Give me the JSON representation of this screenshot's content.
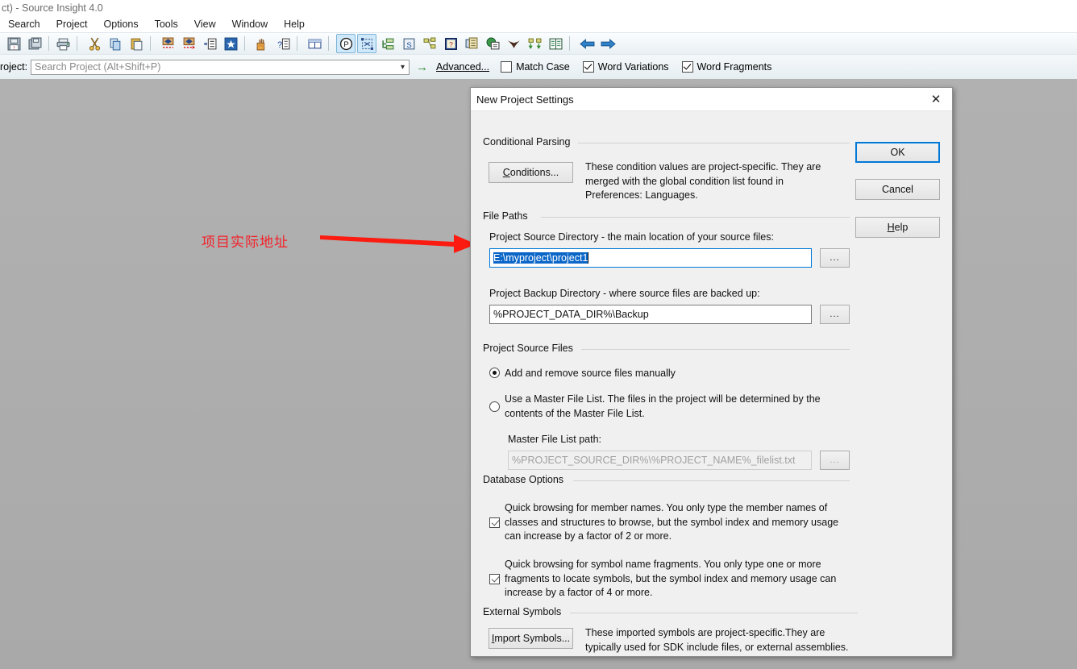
{
  "window": {
    "title": "ct) - Source Insight 4.0"
  },
  "menubar": {
    "items": [
      "Search",
      "Project",
      "Options",
      "Tools",
      "View",
      "Window",
      "Help"
    ]
  },
  "toolbar": {
    "groups": [
      [
        "save-icon",
        "save-all-icon"
      ],
      [
        "print-icon"
      ],
      [
        "cut-icon",
        "copy-icon",
        "paste-icon"
      ],
      [
        "jump-back-icon",
        "jump-forward-icon",
        "indent-icon",
        "bookmark-icon"
      ],
      [
        "highlight-icon",
        "context-help-icon"
      ],
      [
        "tile-windows-icon"
      ],
      [
        "parse-icon",
        "select-block-icon",
        "outline-icon",
        "symbol-window-icon",
        "relation-window-icon",
        "context-window-icon",
        "clip-window-icon",
        "browse-project-icon",
        "web-icon",
        "bird-icon",
        "sync-icon",
        "file-list-icon"
      ],
      [
        "back-arrow-icon",
        "forward-arrow-icon"
      ]
    ]
  },
  "search": {
    "label": "roject:",
    "placeholder": "Search Project (Alt+Shift+P)",
    "value": "",
    "go_label": "→",
    "advanced_label": "Advanced...",
    "options": [
      {
        "label": "Match Case",
        "checked": false
      },
      {
        "label": "Word Variations",
        "checked": true
      },
      {
        "label": "Word Fragments",
        "checked": true
      }
    ]
  },
  "annotation": {
    "text": "项目实际地址",
    "color": "#f3222a",
    "arrow": "right-arrow-annotation"
  },
  "dialog": {
    "title": "New Project Settings",
    "close_label": "✕",
    "buttons": {
      "ok": "OK",
      "cancel": "Cancel",
      "help": "Help"
    },
    "conditional_parsing": {
      "legend": "Conditional Parsing",
      "button": "Conditions...",
      "description": "These condition values are project-specific.  They are merged with the global condition list found in Preferences: Languages."
    },
    "file_paths": {
      "legend": "File Paths",
      "source_dir": {
        "label": "Project Source Directory - the main location of your source files:",
        "value": "E:\\myproject\\project1",
        "browse_label": "...",
        "selected": true
      },
      "backup_dir": {
        "label": "Project Backup Directory - where source files are backed up:",
        "value": "%PROJECT_DATA_DIR%\\Backup",
        "browse_label": "..."
      }
    },
    "project_source_files": {
      "legend": "Project Source Files",
      "option_manual": {
        "label": "Add and remove source files manually",
        "selected": true
      },
      "option_master": {
        "label": "Use a Master File List. The files in the project will be determined by the contents of the Master File List.",
        "selected": false
      },
      "master_path": {
        "label": "Master File List path:",
        "value": "%PROJECT_SOURCE_DIR%\\%PROJECT_NAME%_filelist.txt",
        "browse_label": "...",
        "disabled": true
      }
    },
    "database_options": {
      "legend": "Database Options",
      "members": {
        "checked": true,
        "text": "Quick browsing for member names.  You only type the member names of classes and structures to browse, but the symbol index and memory usage can increase by a factor of 2 or more."
      },
      "fragments": {
        "checked": true,
        "text": "Quick browsing for symbol name fragments.  You only type one or more fragments to locate symbols, but the symbol index and memory usage can increase by a factor of 4 or more."
      }
    },
    "external_symbols": {
      "legend": "External Symbols",
      "button": "Import Symbols...",
      "description": "These imported symbols are project-specific.They are typically used for SDK include files, or external assemblies."
    }
  }
}
